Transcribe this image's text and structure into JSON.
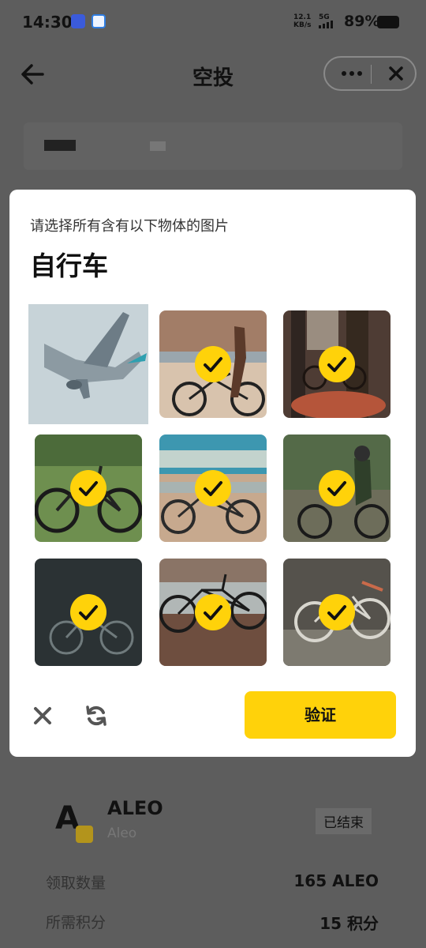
{
  "status_bar": {
    "time": "14:30",
    "net_speed_value": "12.1",
    "net_speed_unit": "KB/s",
    "signal": "5G",
    "battery": "89%"
  },
  "header": {
    "title": "空投"
  },
  "captcha": {
    "prompt": "请选择所有含有以下物体的图片",
    "target": "自行车",
    "verify_label": "验证",
    "tiles": [
      {
        "content": "airplane",
        "selected": false
      },
      {
        "content": "woman-with-bicycle",
        "selected": true
      },
      {
        "content": "bicycle-in-forest",
        "selected": true
      },
      {
        "content": "road-bicycle-on-grass",
        "selected": true
      },
      {
        "content": "bicycle-on-beach",
        "selected": true
      },
      {
        "content": "person-riding-bicycle",
        "selected": true
      },
      {
        "content": "bicycle-in-dark",
        "selected": true
      },
      {
        "content": "bicycle-by-water",
        "selected": true
      },
      {
        "content": "white-bicycle",
        "selected": true
      }
    ],
    "colors": {
      "accent": "#ffd20a"
    }
  },
  "token": {
    "name": "ALEO",
    "subtitle": "Aleo",
    "status": "已结束",
    "rows": [
      {
        "label": "领取数量",
        "value": "165 ALEO"
      },
      {
        "label": "所需积分",
        "value": "15 积分"
      }
    ]
  }
}
